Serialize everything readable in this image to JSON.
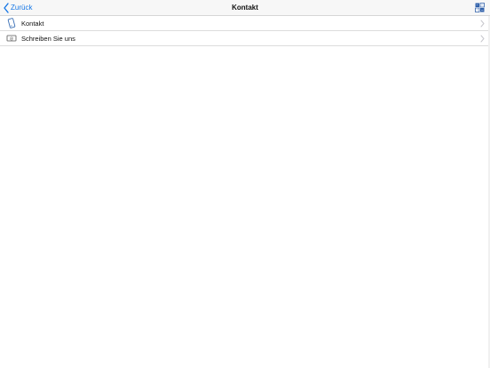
{
  "navbar": {
    "back_label": "Zurück",
    "title": "Kontakt",
    "back_icon": "chevron-left-icon",
    "logo_icon": "app-logo-icon"
  },
  "list": {
    "items": [
      {
        "label": "Kontakt",
        "icon": "phone-icon"
      },
      {
        "label": "Schreiben Sie uns",
        "icon": "email-icon"
      }
    ]
  },
  "colors": {
    "accent": "#1677e6",
    "navbar_bg": "#f7f7f7",
    "separator": "#dcdcdc",
    "chevron": "#c7c7cc"
  }
}
